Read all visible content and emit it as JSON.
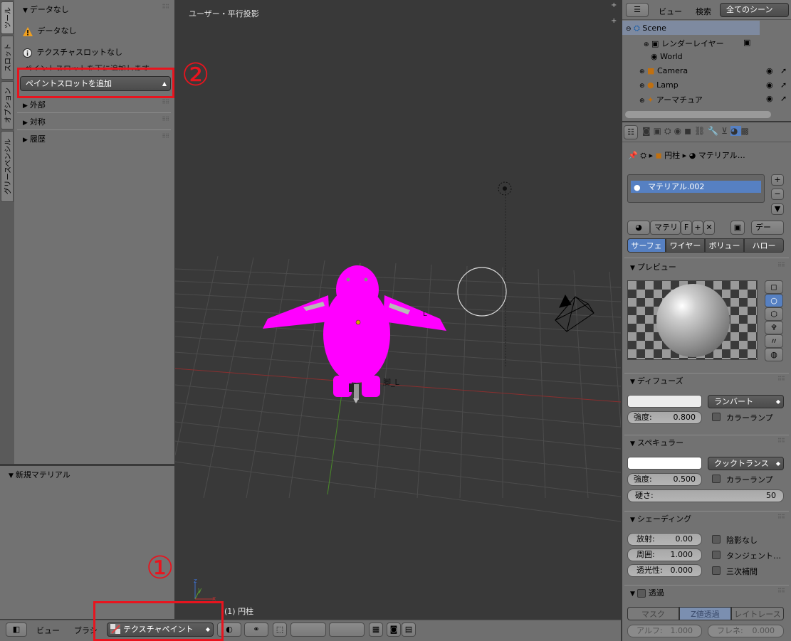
{
  "toolshelf": {
    "tabs": [
      "ツール",
      "スロット",
      "オプション",
      "グリースペンシル"
    ],
    "panel_title": "データなし",
    "warning_text": "データなし",
    "info_text": "テクスチャスロットなし",
    "hint_text": "ペイントスロットを下に追加します",
    "add_slot_button": "ペイントスロットを追加",
    "collapsed_panels": [
      "外部",
      "対称",
      "履歴"
    ]
  },
  "lower_panel": {
    "title": "新規マテリアル"
  },
  "viewport": {
    "view_label": "ユーザー・平行投影",
    "object_label": "(1) 円柱",
    "bone_label_1": "脚_L",
    "bone_label_2": "L",
    "mesh_color": "#ff00ff"
  },
  "bottombar": {
    "view_menu": "ビュー",
    "brush_menu": "ブラシ",
    "mode_select": "テクスチャペイント"
  },
  "annotations": {
    "one": "①",
    "two": "②",
    "color": "#e8141e"
  },
  "outliner": {
    "view_menu": "ビュー",
    "search_menu": "検索",
    "filter_select": "全てのシーン",
    "items": [
      {
        "label": "Scene"
      },
      {
        "label": "レンダーレイヤー"
      },
      {
        "label": "World"
      },
      {
        "label": "Camera"
      },
      {
        "label": "Lamp"
      },
      {
        "label": "アーマチュア"
      }
    ]
  },
  "properties": {
    "breadcrumb": [
      "円柱",
      "マテリアル…"
    ],
    "material_slot": "マテリアル.002",
    "material_name_field": "マテリ",
    "fake_user": "F",
    "data_select": "デー",
    "tabs": [
      "サーフェ",
      "ワイヤー",
      "ボリュー",
      "ハロー"
    ],
    "preview_title": "プレビュー",
    "diffuse": {
      "title": "ディフューズ",
      "shader": "ランバート",
      "intensity_label": "強度:",
      "intensity": "0.800",
      "ramp": "カラーランプ"
    },
    "specular": {
      "title": "スペキュラー",
      "shader": "クックトランス",
      "intensity_label": "強度:",
      "intensity": "0.500",
      "ramp": "カラーランプ",
      "hardness_label": "硬さ:",
      "hardness": "50"
    },
    "shading": {
      "title": "シェーディング",
      "emit_label": "放射:",
      "emit": "0.00",
      "ambient_label": "周囲:",
      "ambient": "1.000",
      "translucency_label": "透光性:",
      "translucency": "0.000",
      "shadeless": "陰影なし",
      "tangent": "タンジェント…",
      "cubic": "三次補間"
    },
    "transparency": {
      "title": "透過",
      "tabs": [
        "マスク",
        "Z値透過",
        "レイトレース"
      ],
      "alpha_label": "アルフ:",
      "alpha": "1.000",
      "fresnel_label": "フレネ:",
      "fresnel": "0.000"
    }
  }
}
